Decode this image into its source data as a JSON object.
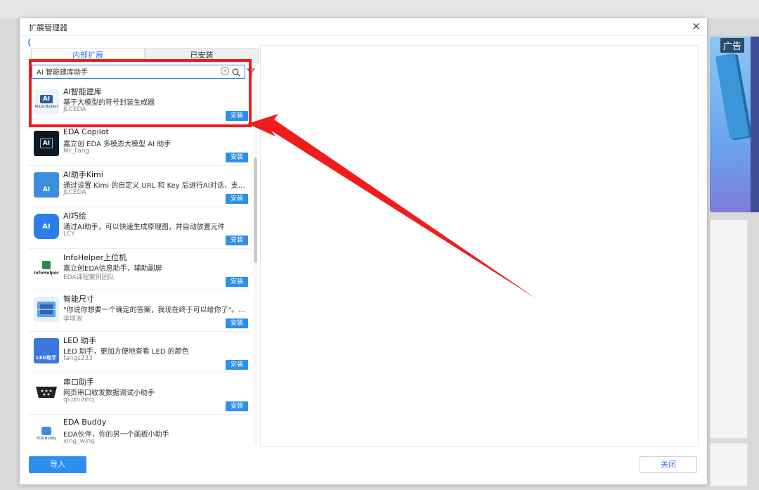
{
  "window": {
    "title": "扩展管理器",
    "close_glyph": "×"
  },
  "background": {
    "ad_label": "广告"
  },
  "tabs": [
    {
      "label": "内部扩展",
      "active": true
    },
    {
      "label": "已安装",
      "active": false
    }
  ],
  "search": {
    "value": "AI 智能建库助手",
    "clear_glyph": "×"
  },
  "extensions": [
    {
      "name": "AI智能建库",
      "desc": "基于大模型的符号封装生成器",
      "author": "JLCEDA",
      "icon": "ai-lib-builder-icon",
      "thumb_text": "AI",
      "thumb_caption": "AI-Lib-Builder",
      "install": "安装"
    },
    {
      "name": "EDA Copilot",
      "desc": "嘉立创 EDA 多模态大模型 AI 助手",
      "author": "Mr_Fang",
      "icon": "eda-copilot-icon",
      "thumb_text": "AI",
      "install": "安装"
    },
    {
      "name": "AI助手Kimi",
      "desc": "通过设置 Kimi 的自定义 URL 和 Key 后进行AI对话，支持...",
      "author": "JLCEDA",
      "icon": "ai-kimi-icon",
      "thumb_text": "AI",
      "install": "安装"
    },
    {
      "name": "AI巧绘",
      "desc": "通过AI助手，可以快速生成原理图，并自动放置元件",
      "author": "LCY",
      "icon": "ai-qiaohui-icon",
      "thumb_text": "AI",
      "install": "安装"
    },
    {
      "name": "InfoHelper上位机",
      "desc": "嘉立创EDA信息助手，辅助副屏",
      "author": "EDA课程案例团队",
      "icon": "infohelper-icon",
      "thumb_text": "InfoHelper",
      "install": "安装"
    },
    {
      "name": "智能尺寸",
      "desc": "\"你说你想要一个确定的答案，我现在终于可以给你了\"。...",
      "author": "李增浪",
      "icon": "smart-dimension-icon",
      "thumb_text": "",
      "install": "安装"
    },
    {
      "name": "LED 助手",
      "desc": "LED 助手，更加方便地查看 LED 的颜色",
      "author": "fangs233",
      "icon": "led-helper-icon",
      "thumb_text": "LED助手",
      "install": "安装"
    },
    {
      "name": "串口助手",
      "desc": "网页串口收发数据调试小助手",
      "author": "qiuzhihhq",
      "icon": "serial-port-icon",
      "thumb_text": "",
      "install": "安装"
    },
    {
      "name": "EDA Buddy",
      "desc": "EDA伙伴，你的另一个画板小助手",
      "author": "xing_wing",
      "icon": "eda-buddy-icon",
      "thumb_text": "EDA Buddy",
      "install": "安装"
    }
  ],
  "footer": {
    "import_label": "导入",
    "close_label": "关闭"
  },
  "colors": {
    "accent": "#2c8ef0",
    "highlight": "#f01c1c"
  }
}
